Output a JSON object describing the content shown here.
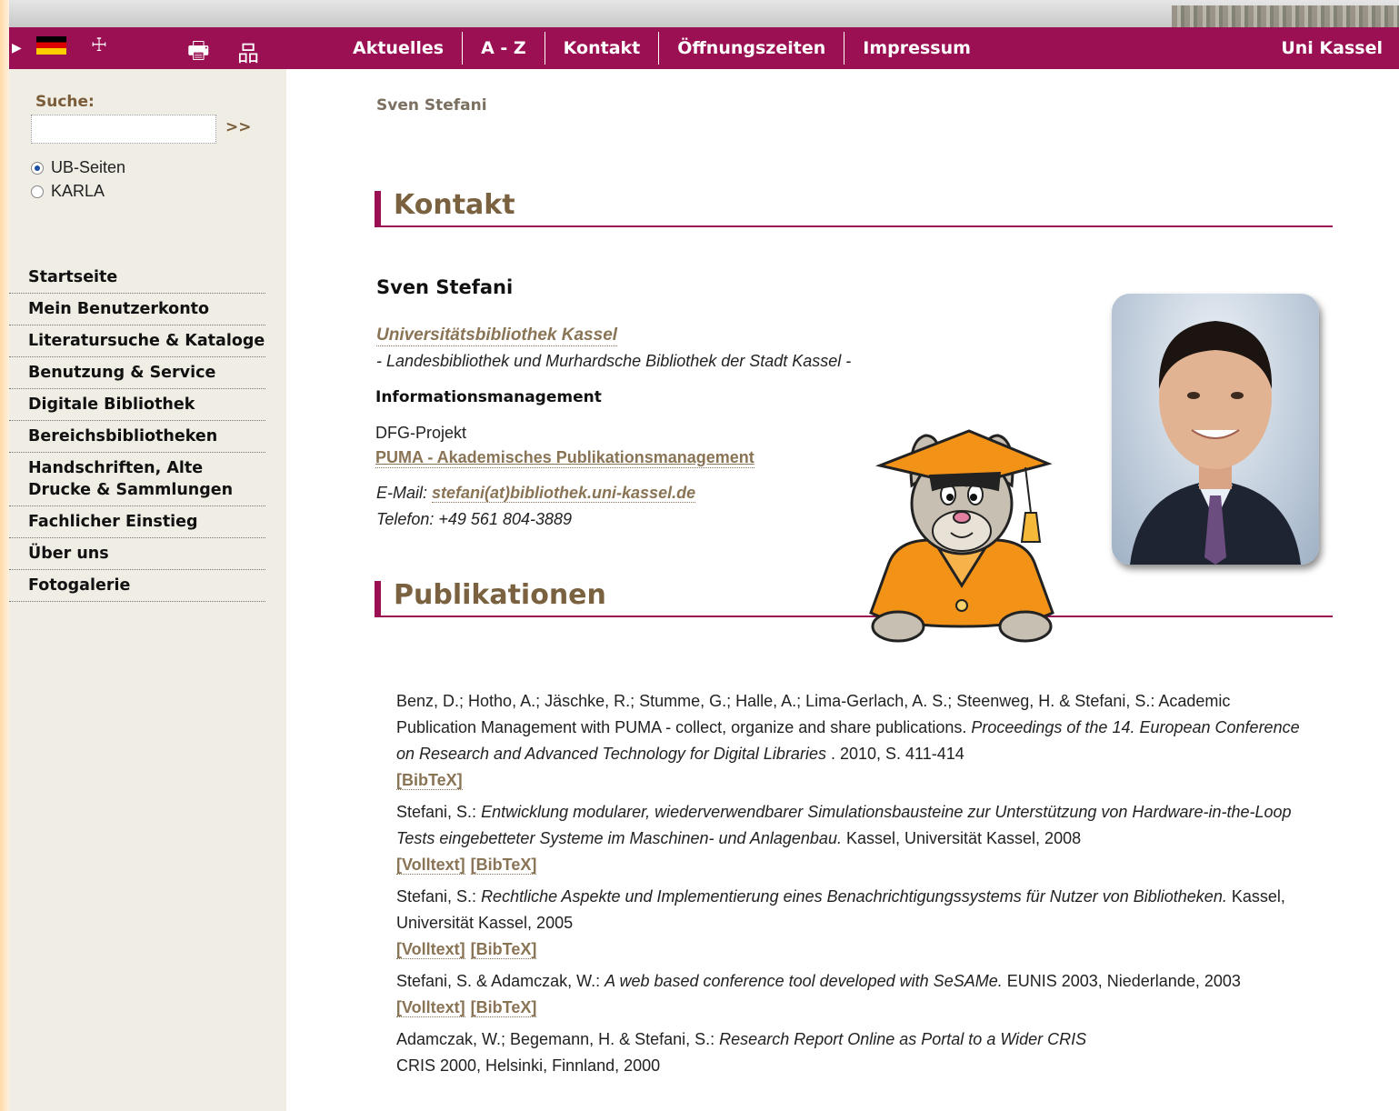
{
  "header": {
    "language_de": "Deutsch",
    "language_en": "English",
    "nav": [
      "Aktuelles",
      "A - Z",
      "Kontakt",
      "Öffnungszeiten",
      "Impressum"
    ],
    "uni_link": "Uni Kassel",
    "accent_color": "#9a1053"
  },
  "sidebar": {
    "search_label": "Suche:",
    "search_value": "",
    "search_go": ">>",
    "radio_options": [
      {
        "label": "UB-Seiten",
        "selected": true
      },
      {
        "label": "KARLA",
        "selected": false
      }
    ],
    "nav": [
      "Startseite",
      "Mein Benutzerkonto",
      "Literatursuche & Kataloge",
      "Benutzung & Service",
      "Digitale Bibliothek",
      "Bereichsbibliotheken",
      "Handschriften, Alte Drucke & Sammlungen",
      "Fachlicher Einstieg",
      "Über uns",
      "Fotogalerie"
    ]
  },
  "main": {
    "breadcrumb": "Sven Stefani",
    "kontakt_heading": "Kontakt",
    "name": "Sven Stefani",
    "org_link": "Universitätsbibliothek Kassel",
    "org_sub": "- Landesbibliothek und Murhardsche Bibliothek der Stadt Kassel -",
    "department": "Informationsmanagement",
    "project": "DFG-Projekt",
    "project_link": "PUMA - Akademisches Publikationsmanagement",
    "email_label": "E-Mail:",
    "email": "stefani(at)bibliothek.uni-kassel.de",
    "phone": "Telefon: +49 561 804-3889",
    "publications_heading": "Publikationen"
  },
  "publications": [
    {
      "pre": "Benz, D.; Hotho, A.; Jäschke, R.; Stumme, G.; Halle, A.; Lima-Gerlach, A. S.; Steenweg, H. & Stefani, S.: Academic Publication Management with PUMA - collect, organize and share publications. ",
      "italic": "Proceedings of the 14. European Conference on Research and Advanced Technology for Digital Libraries",
      "post": " . 2010, S. 411-414",
      "volltext": "",
      "bibtex": "[BibTeX]"
    },
    {
      "pre": "Stefani, S.: ",
      "italic": "Entwicklung modularer, wiederverwendbarer Simulationsbausteine zur Unterstützung von Hardware-in-the-Loop Tests eingebetteter Systeme im Maschinen- und Anlagenbau.",
      "post": " Kassel, Universität Kassel, 2008",
      "volltext": "[Volltext]",
      "bibtex": "[BibTeX]"
    },
    {
      "pre": "Stefani, S.: ",
      "italic": "Rechtliche Aspekte und Implementierung eines Benachrichtigungssystems für Nutzer von Bibliotheken.",
      "post": " Kassel, Universität Kassel, 2005",
      "volltext": "[Volltext]",
      "bibtex": "[BibTeX]"
    },
    {
      "pre": "Stefani, S. & Adamczak, W.: ",
      "italic": "A web based conference tool developed with SeSAMe.",
      "post": " EUNIS 2003, Niederlande, 2003",
      "volltext": "[Volltext]",
      "bibtex": "[BibTeX]"
    },
    {
      "pre": "Adamczak, W.; Begemann, H. & Stefani, S.: ",
      "italic": "Research Report Online as Portal to a Wider CRIS",
      "post": " CRIS 2000, Helsinki, Finnland, 2000",
      "volltext": "",
      "bibtex": ""
    }
  ]
}
